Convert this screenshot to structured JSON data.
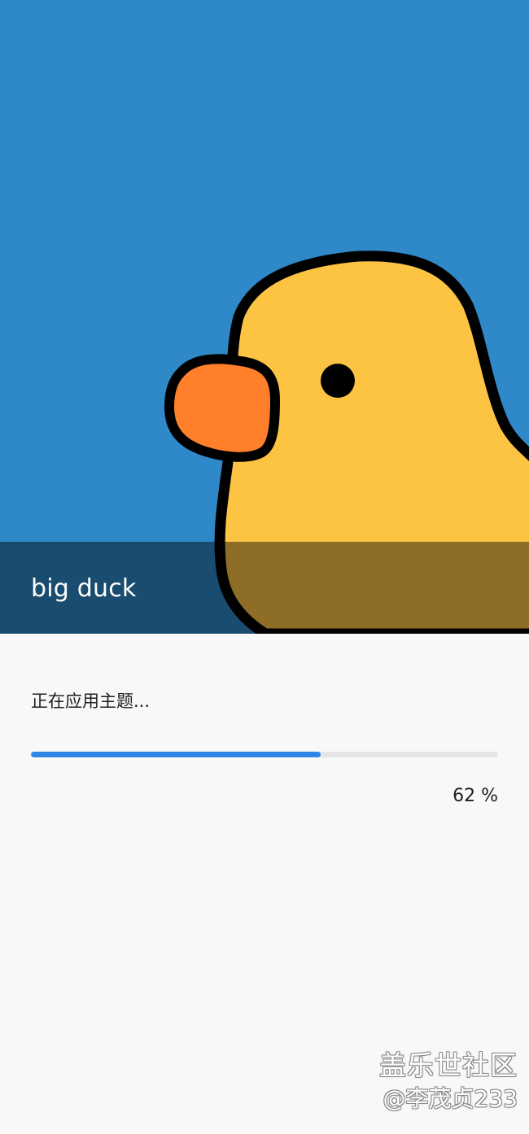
{
  "theme": {
    "name": "big duck",
    "illustration": "yellow-duck-with-orange-beak",
    "colors": {
      "sky": "#2f88c8",
      "duck_body": "#fdc444",
      "beak": "#ff7f2a",
      "outline": "#000000",
      "name_bar_overlay": "rgba(0,0,0,0.44)"
    }
  },
  "apply": {
    "status": "正在应用主题...",
    "progress": 0.62,
    "progress_label": "62 %",
    "colors": {
      "track": "#e6e6e6",
      "fill": "#2d86e6"
    }
  },
  "watermark": {
    "site": "盖乐世社区",
    "author": "@李茂贞233"
  }
}
